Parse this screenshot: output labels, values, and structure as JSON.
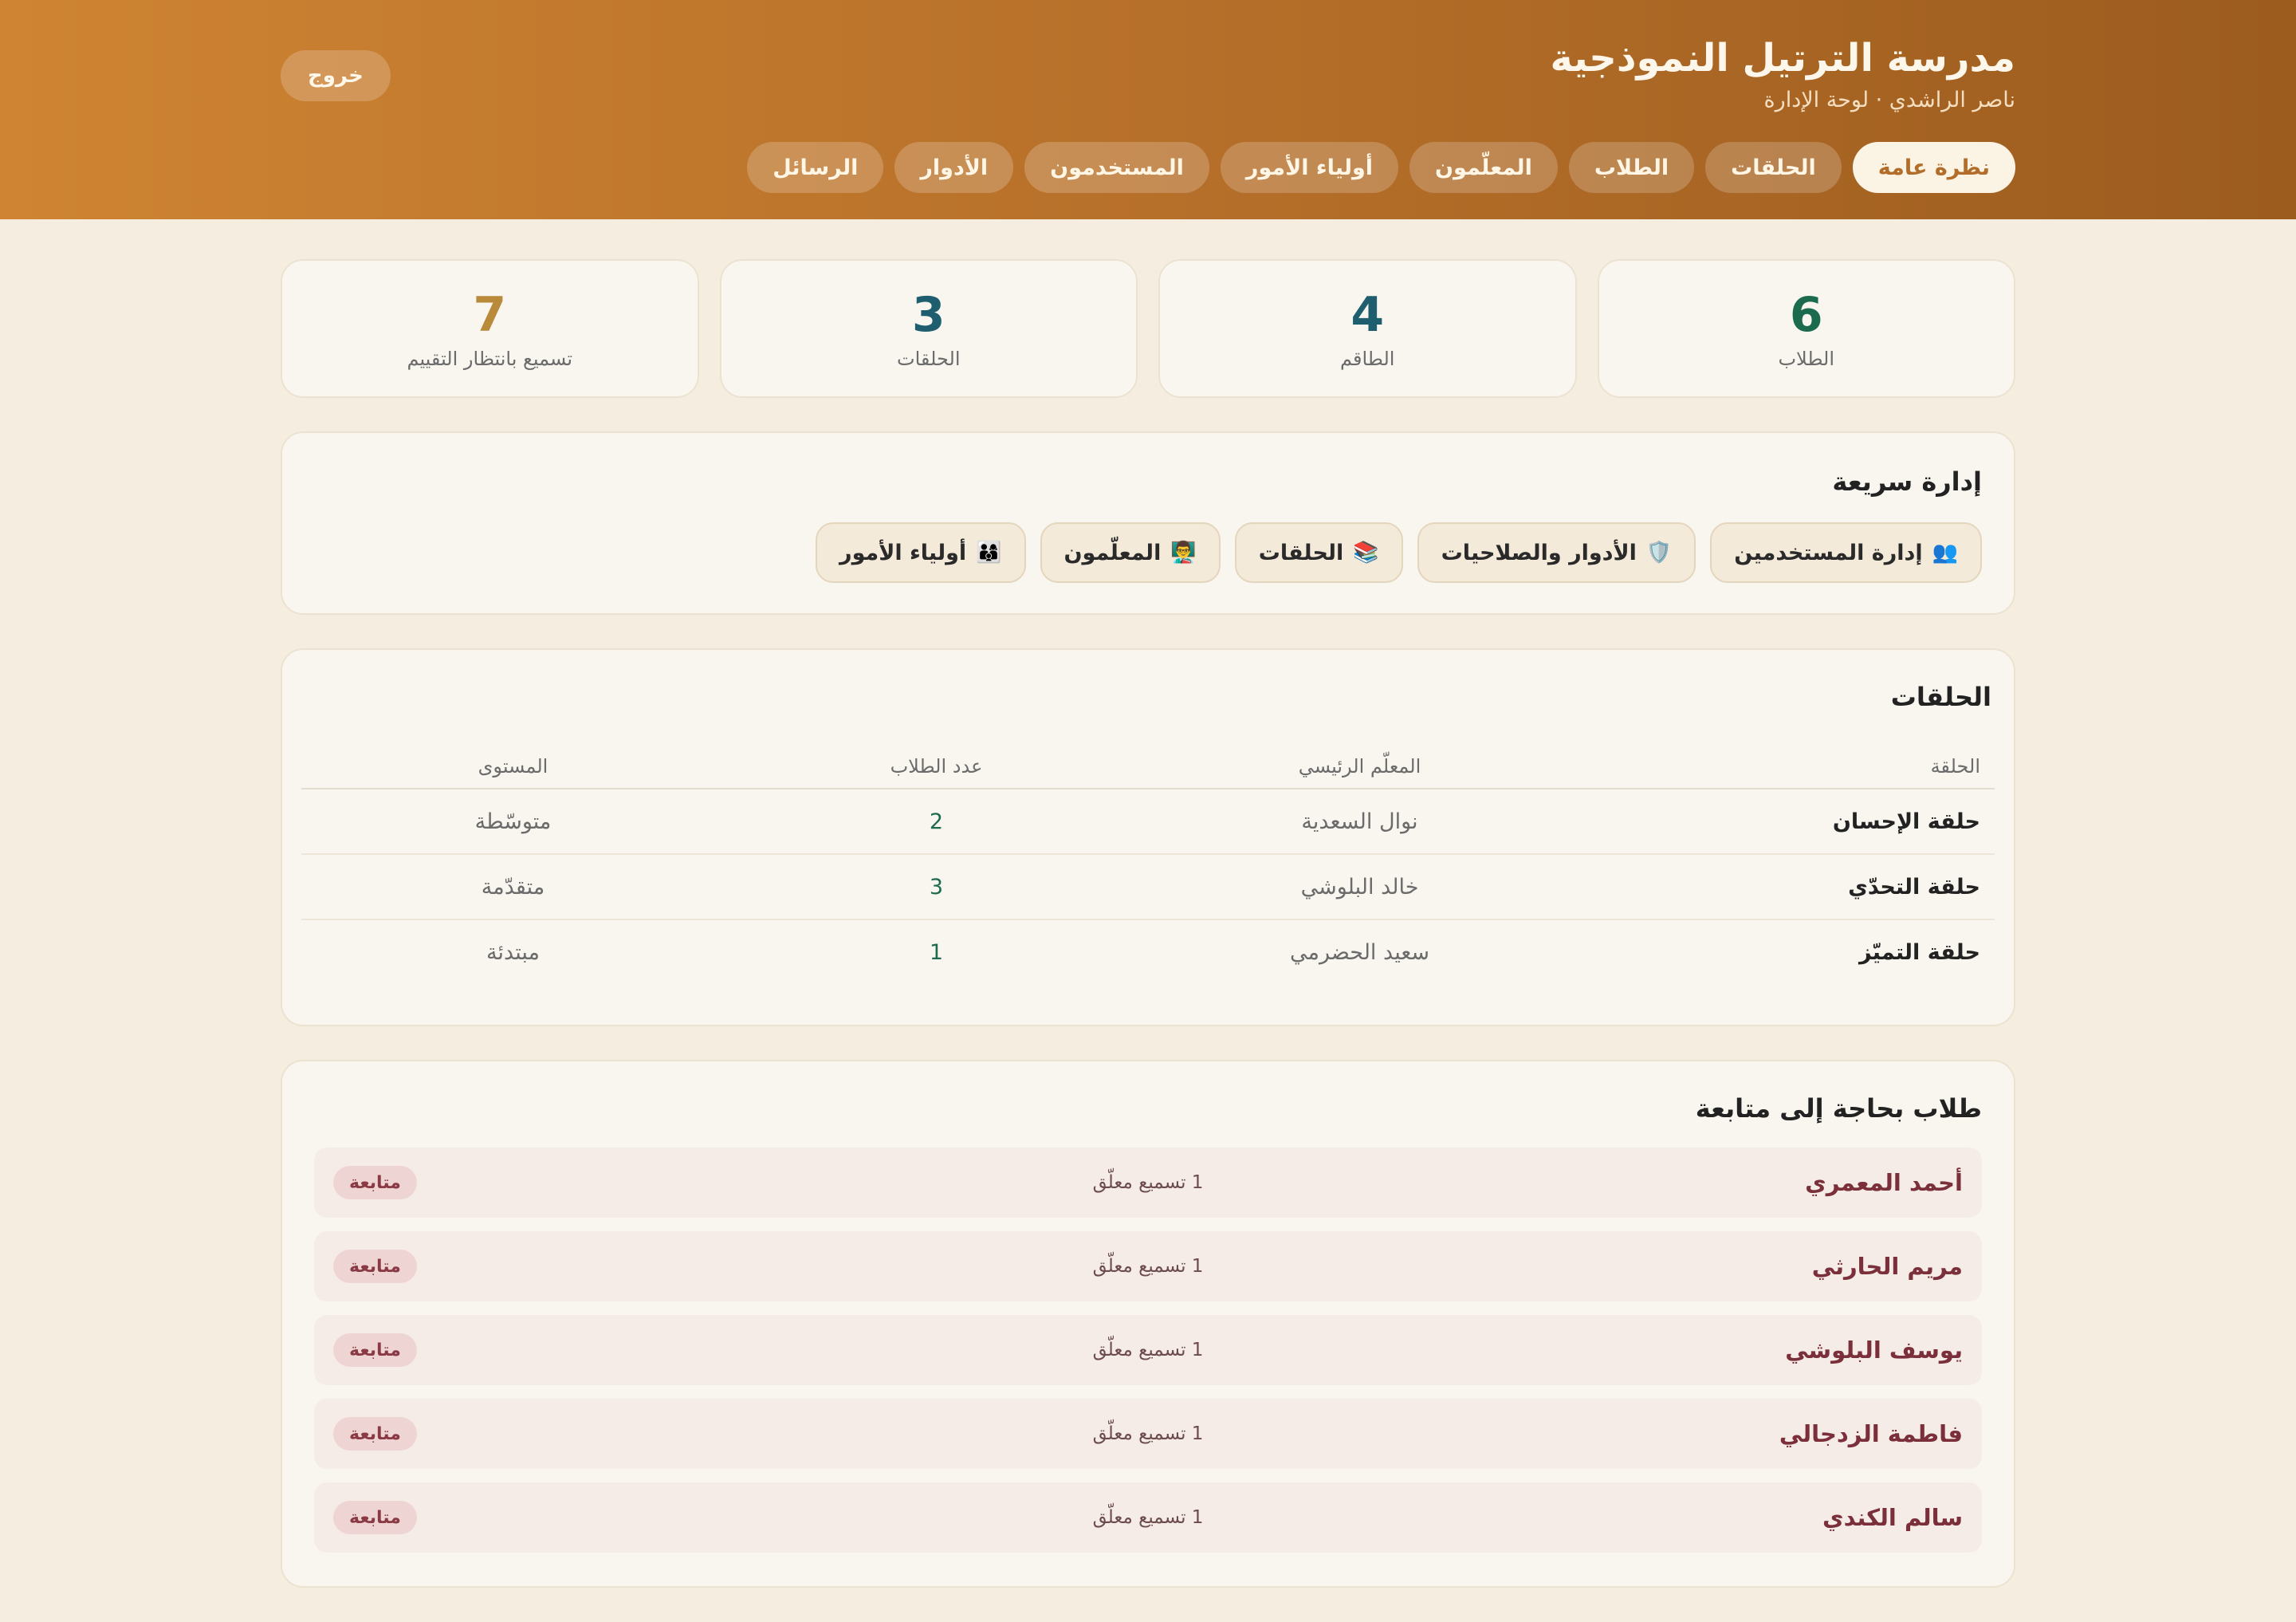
{
  "header": {
    "title": "مدرسة الترتيل النموذجية",
    "subtitle": "ناصر الراشدي · لوحة الإدارة",
    "logout_label": "خروج",
    "nav": [
      {
        "label": "نظرة عامة",
        "active": true
      },
      {
        "label": "الحلقات"
      },
      {
        "label": "الطلاب"
      },
      {
        "label": "المعلّمون"
      },
      {
        "label": "أولياء الأمور"
      },
      {
        "label": "المستخدمون"
      },
      {
        "label": "الأدوار"
      },
      {
        "label": "الرسائل"
      }
    ]
  },
  "stats": [
    {
      "value": "6",
      "label": "الطلاب",
      "color": "#1d6b4e"
    },
    {
      "value": "4",
      "label": "الطاقم",
      "color": "#1e5e6e"
    },
    {
      "value": "3",
      "label": "الحلقات",
      "color": "#1e5e6e"
    },
    {
      "value": "7",
      "label": "تسميع بانتظار التقييم",
      "color": "#b88a3a"
    }
  ],
  "quick": {
    "title": "إدارة سريعة",
    "buttons": [
      {
        "icon": "👥",
        "icon_name": "users-icon",
        "label": "إدارة المستخدمين"
      },
      {
        "icon": "🛡️",
        "icon_name": "shield-icon",
        "label": "الأدوار والصلاحيات"
      },
      {
        "icon": "📚",
        "icon_name": "books-icon",
        "label": "الحلقات"
      },
      {
        "icon": "👨‍🏫",
        "icon_name": "teacher-icon",
        "label": "المعلّمون"
      },
      {
        "icon": "👨‍👩‍👦",
        "icon_name": "family-icon",
        "label": "أولياء الأمور"
      }
    ]
  },
  "circles": {
    "title": "الحلقات",
    "columns": [
      "الحلقة",
      "المعلّم الرئيسي",
      "عدد الطلاب",
      "المستوى"
    ],
    "rows": [
      {
        "name": "حلقة الإحسان",
        "teacher": "نوال السعدية",
        "count": "2",
        "level": "متوسّطة"
      },
      {
        "name": "حلقة التحدّي",
        "teacher": "خالد البلوشي",
        "count": "3",
        "level": "متقدّمة"
      },
      {
        "name": "حلقة التميّز",
        "teacher": "سعيد الحضرمي",
        "count": "1",
        "level": "مبتدئة"
      }
    ]
  },
  "followup": {
    "title": "طلاب بحاجة إلى متابعة",
    "rows": [
      {
        "name": "أحمد المعمري",
        "note": "1 تسميع معلّق",
        "badge": "متابعة"
      },
      {
        "name": "مريم الحارثي",
        "note": "1 تسميع معلّق",
        "badge": "متابعة"
      },
      {
        "name": "يوسف البلوشي",
        "note": "1 تسميع معلّق",
        "badge": "متابعة"
      },
      {
        "name": "فاطمة الزدجالي",
        "note": "1 تسميع معلّق",
        "badge": "متابعة"
      },
      {
        "name": "سالم الكندي",
        "note": "1 تسميع معلّق",
        "badge": "متابعة"
      }
    ]
  }
}
